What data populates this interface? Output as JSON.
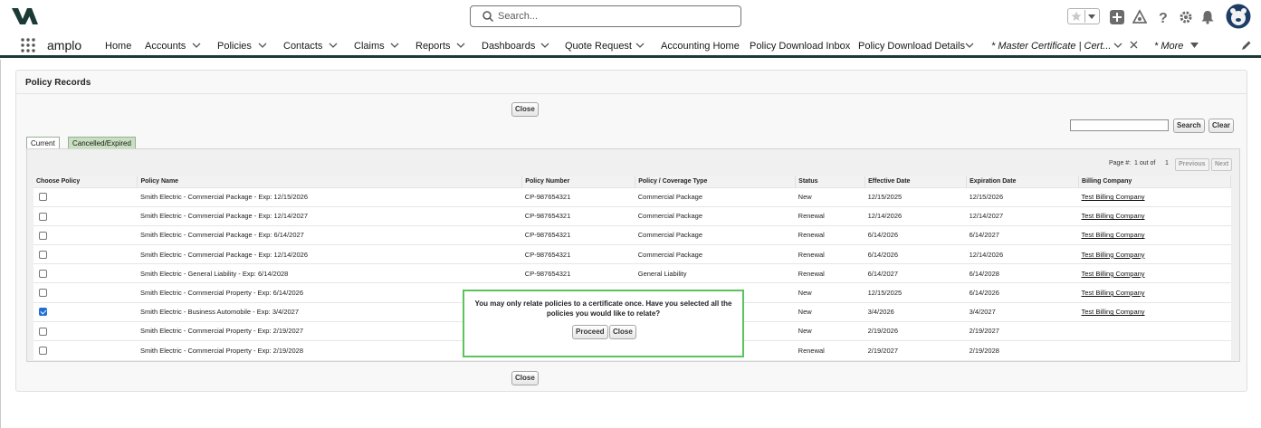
{
  "header": {
    "search_placeholder": "Search..."
  },
  "nav": {
    "app_name": "amplo",
    "items": [
      {
        "label": "Home",
        "has_menu": false
      },
      {
        "label": "Accounts",
        "has_menu": true
      },
      {
        "label": "Policies",
        "has_menu": true
      },
      {
        "label": "Contacts",
        "has_menu": true
      },
      {
        "label": "Claims",
        "has_menu": true
      },
      {
        "label": "Reports",
        "has_menu": true
      },
      {
        "label": "Dashboards",
        "has_menu": true
      },
      {
        "label": "Quote Request",
        "has_menu": true
      },
      {
        "label": "Accounting Home",
        "has_menu": false
      },
      {
        "label": "Policy Download Inbox",
        "has_menu": false
      },
      {
        "label": "Policy Download Details",
        "has_menu": true
      }
    ],
    "active_tab": "* Master Certificate | Cert...",
    "more": "* More"
  },
  "panel": {
    "title": "Policy Records",
    "close_label": "Close",
    "search_label": "Search",
    "clear_label": "Clear",
    "tabs": [
      "Current",
      "Cancelled/Expired"
    ],
    "page_label": "Page #:",
    "page_info": "1 out of",
    "page_total": "1",
    "previous_label": "Previous",
    "next_label": "Next"
  },
  "table": {
    "headers": [
      "Choose Policy",
      "Policy Name",
      "Policy Number",
      "Policy / Coverage Type",
      "Status",
      "Effective Date",
      "Expiration Date",
      "Billing Company"
    ],
    "rows": [
      {
        "checked": false,
        "name": "Smith Electric - Commercial Package - Exp: 12/15/2026",
        "number": "CP-987654321",
        "type": "Commercial Package",
        "status": "New",
        "effective": "12/15/2025",
        "expiration": "12/15/2026",
        "billing": "Test Billing Company"
      },
      {
        "checked": false,
        "name": "Smith Electric - Commercial Package - Exp: 12/14/2027",
        "number": "CP-987654321",
        "type": "Commercial Package",
        "status": "Renewal",
        "effective": "12/14/2026",
        "expiration": "12/14/2027",
        "billing": "Test Billing Company"
      },
      {
        "checked": false,
        "name": "Smith Electric - Commercial Package - Exp: 6/14/2027",
        "number": "CP-987654321",
        "type": "Commercial Package",
        "status": "Renewal",
        "effective": "6/14/2026",
        "expiration": "6/14/2027",
        "billing": "Test Billing Company"
      },
      {
        "checked": false,
        "name": "Smith Electric - Commercial Package - Exp: 12/14/2026",
        "number": "CP-987654321",
        "type": "Commercial Package",
        "status": "Renewal",
        "effective": "6/14/2026",
        "expiration": "12/14/2026",
        "billing": "Test Billing Company"
      },
      {
        "checked": false,
        "name": "Smith Electric - General Liability - Exp: 6/14/2028",
        "number": "CP-987654321",
        "type": "General Liability",
        "status": "Renewal",
        "effective": "6/14/2027",
        "expiration": "6/14/2028",
        "billing": "Test Billing Company"
      },
      {
        "checked": false,
        "name": "Smith Electric - Commercial Property - Exp: 6/14/2026",
        "number": "",
        "type": "",
        "status": "New",
        "effective": "12/15/2025",
        "expiration": "6/14/2026",
        "billing": "Test Billing Company"
      },
      {
        "checked": true,
        "name": "Smith Electric - Business Automobile - Exp: 3/4/2027",
        "number": "",
        "type": "",
        "status": "New",
        "effective": "3/4/2026",
        "expiration": "3/4/2027",
        "billing": "Test Billing Company"
      },
      {
        "checked": false,
        "name": "Smith Electric - Commercial Property - Exp: 2/19/2027",
        "number": "",
        "type": "",
        "status": "New",
        "effective": "2/19/2026",
        "expiration": "2/19/2027",
        "billing": ""
      },
      {
        "checked": false,
        "name": "Smith Electric - Commercial Property - Exp: 2/19/2028",
        "number": "",
        "type": "",
        "status": "Renewal",
        "effective": "2/19/2027",
        "expiration": "2/19/2028",
        "billing": ""
      }
    ]
  },
  "dialog": {
    "message": "You may only relate policies to a certificate once. Have you selected all the policies you would like to relate?",
    "proceed_label": "Proceed",
    "close_label": "Close"
  },
  "colors": {
    "nav_border": "#1b3a35",
    "dialog_border": "#5cc35c",
    "tab_inactive": "#c8e0c0",
    "checkbox_checked": "#1f6fd6"
  }
}
